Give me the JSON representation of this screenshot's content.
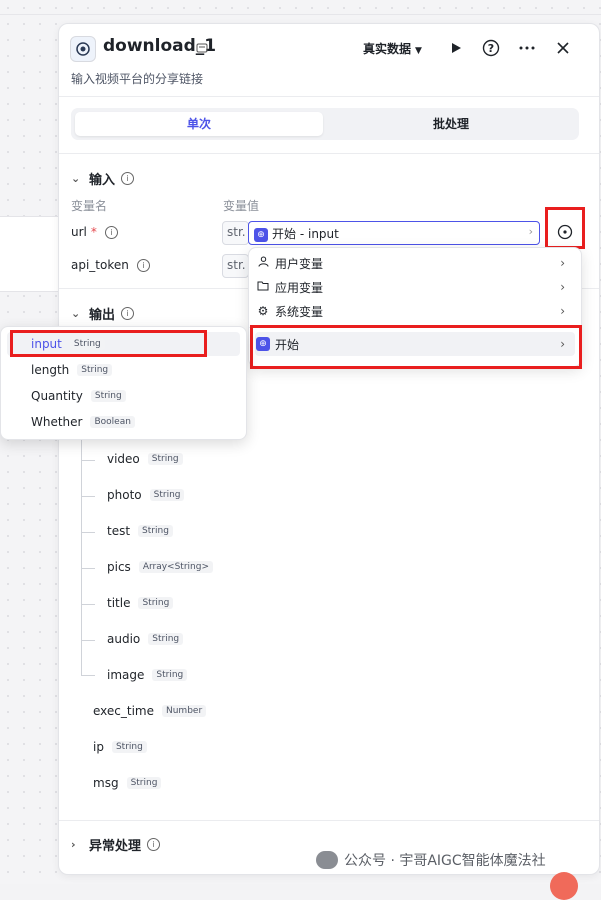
{
  "header": {
    "title": "download_1",
    "subtitle": "输入视频平台的分享链接",
    "real_data_label": "真实数据",
    "icons": [
      "node-icon",
      "badge-icon",
      "play-icon",
      "help-icon",
      "more-icon",
      "close-icon"
    ]
  },
  "tabs": [
    {
      "label": "单次",
      "active": true
    },
    {
      "label": "批处理",
      "active": false
    }
  ],
  "input_section": {
    "title": "输入",
    "col_name": "变量名",
    "col_value": "变量值",
    "fields": [
      {
        "name": "url",
        "required": true,
        "prefix": "str.",
        "ref_source": "开始",
        "ref_var": "input"
      },
      {
        "name": "api_token",
        "required": false,
        "prefix": "str."
      }
    ]
  },
  "dropdown": {
    "items": [
      {
        "label": "用户变量",
        "icon": "user-icon"
      },
      {
        "label": "应用变量",
        "icon": "folder-icon"
      },
      {
        "label": "系统变量",
        "icon": "gear-icon"
      },
      {
        "label": "开始",
        "icon": "start-node-icon"
      }
    ]
  },
  "popover": {
    "items": [
      {
        "name": "input",
        "type": "String"
      },
      {
        "name": "length",
        "type": "String"
      },
      {
        "name": "Quantity",
        "type": "String"
      },
      {
        "name": "Whether",
        "type": "Boolean"
      }
    ]
  },
  "output_section": {
    "title": "输出",
    "children": [
      {
        "name": "video",
        "type": "String"
      },
      {
        "name": "photo",
        "type": "String"
      },
      {
        "name": "test",
        "type": "String"
      },
      {
        "name": "pics",
        "type": "Array<String>"
      },
      {
        "name": "title",
        "type": "String"
      },
      {
        "name": "audio",
        "type": "String"
      },
      {
        "name": "image",
        "type": "String"
      }
    ],
    "top_level": [
      {
        "name": "exec_time",
        "type": "Number"
      },
      {
        "name": "ip",
        "type": "String"
      },
      {
        "name": "msg",
        "type": "String"
      }
    ]
  },
  "exception_section": {
    "title": "异常处理"
  },
  "watermark": "公众号 · 宇哥AIGC智能体魔法社",
  "colors": {
    "accent": "#4d53e8",
    "highlight": "#e91e1e",
    "required": "#e5484d"
  }
}
